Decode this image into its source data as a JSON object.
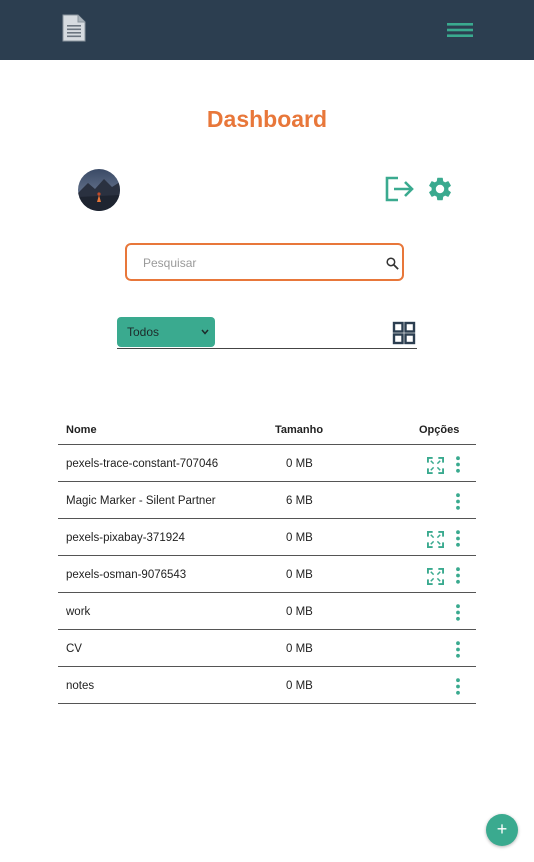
{
  "header": {
    "logo_icon": "document-icon",
    "menu_icon": "hamburger-menu-icon",
    "bg_color": "#2c3e50"
  },
  "page": {
    "title": "Dashboard",
    "title_color": "#e8773a"
  },
  "profile": {
    "avatar": "user-avatar",
    "logout_icon": "logout-icon",
    "settings_icon": "gear-icon",
    "accent": "#3aaa8f"
  },
  "search": {
    "placeholder": "Pesquisar",
    "value": "",
    "icon": "search-icon"
  },
  "filter": {
    "selected": "Todos",
    "view_icon": "grid-view-icon"
  },
  "table": {
    "headers": {
      "name": "Nome",
      "size": "Tamanho",
      "options": "Opções"
    },
    "rows": [
      {
        "name": "pexels-trace-constant-707046",
        "size": "0 MB",
        "expandable": true
      },
      {
        "name": "Magic Marker - Silent Partner",
        "size": "6 MB",
        "expandable": false
      },
      {
        "name": "pexels-pixabay-371924",
        "size": "0 MB",
        "expandable": true
      },
      {
        "name": "pexels-osman-9076543",
        "size": "0 MB",
        "expandable": true
      },
      {
        "name": "work",
        "size": "0 MB",
        "expandable": false
      },
      {
        "name": "CV",
        "size": "0 MB",
        "expandable": false
      },
      {
        "name": "notes",
        "size": "0 MB",
        "expandable": false
      }
    ]
  },
  "fab": {
    "label": "+"
  }
}
